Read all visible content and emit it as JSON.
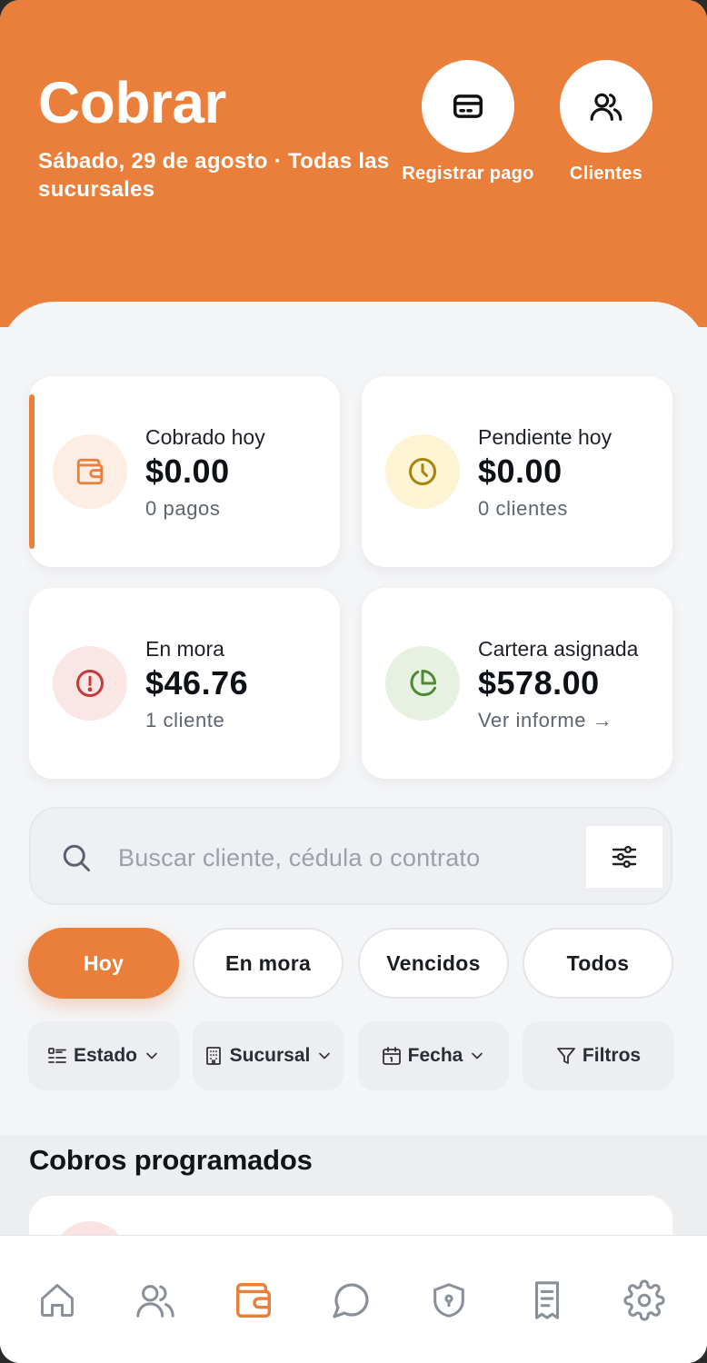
{
  "header": {
    "title": "Cobrar",
    "subtitle": "Sábado, 29 de agosto · Todas las sucursales",
    "actions": [
      {
        "label": "Registrar pago",
        "icon": "card-icon"
      },
      {
        "label": "Clientes",
        "icon": "users-icon"
      }
    ]
  },
  "stats": {
    "cobrado": {
      "title": "Cobrado hoy",
      "value": "$0.00",
      "sub": "0 pagos",
      "icon": "wallet-icon"
    },
    "pendiente": {
      "title": "Pendiente hoy",
      "value": "$0.00",
      "sub": "0 clientes",
      "icon": "clock-icon"
    },
    "mora": {
      "title": "En mora",
      "value": "$46.76",
      "sub": "1 cliente",
      "icon": "alert-icon"
    },
    "cartera": {
      "title": "Cartera asignada",
      "value": "$578.00",
      "sub": "Ver informe →",
      "icon": "pie-chart-icon"
    }
  },
  "search": {
    "placeholder": "Buscar cliente, cédula o contrato",
    "value": ""
  },
  "tabs": [
    {
      "label": "Hoy",
      "active": true
    },
    {
      "label": "En mora",
      "active": false
    },
    {
      "label": "Vencidos",
      "active": false
    },
    {
      "label": "Todos",
      "active": false
    }
  ],
  "filters": [
    {
      "label": "Estado",
      "icon": "list-icon"
    },
    {
      "label": "Sucursal",
      "icon": "building-icon"
    },
    {
      "label": "Fecha",
      "icon": "calendar-icon"
    },
    {
      "label": "Filtros",
      "icon": "funnel-icon"
    }
  ],
  "section": {
    "title": "Cobros programados"
  },
  "nav": [
    {
      "icon": "home-icon",
      "active": false
    },
    {
      "icon": "users-icon",
      "active": false
    },
    {
      "icon": "wallet-icon",
      "active": true
    },
    {
      "icon": "chat-icon",
      "active": false
    },
    {
      "icon": "shield-icon",
      "active": false
    },
    {
      "icon": "receipt-icon",
      "active": false
    },
    {
      "icon": "gear-icon",
      "active": false
    }
  ],
  "colors": {
    "accent": "#e97f3b",
    "background": "#f4f5f7",
    "text": "#111418",
    "muted": "#5d6470"
  }
}
